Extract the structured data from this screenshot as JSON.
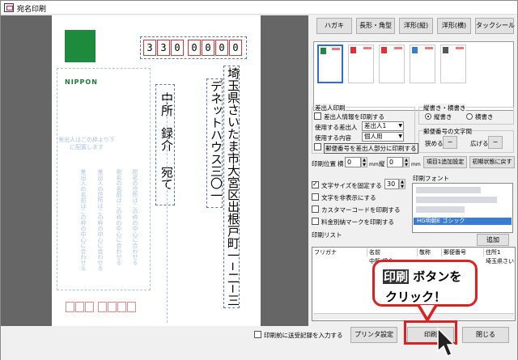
{
  "window": {
    "title": "宛名印刷"
  },
  "card": {
    "logo_text": "NIPPON",
    "zip_digits": [
      "3",
      "3",
      "0",
      "0",
      "0",
      "0",
      "0"
    ],
    "address_line1": "埼玉県さいたま市大宮区出根戸町一−二−三",
    "address_line2": "デネットハウス三〇一",
    "recipient_name_prefix": "中所",
    "recipient_name_first": "録介",
    "recipient_honorific": "宛て",
    "sender_note": "差出人はこの枠より下に配置します",
    "ghost_sender_addr": "差出人の住所はこの枠の中心に合わせる",
    "ghost_sender_name": "差出人の名前はこの枠の中心に合わせる",
    "ghost_recipient_addr": "宛名の住所はこの枠の中心に合わせる",
    "ghost_recipient_name": "宛名の名前はこの枠の中心に合わせる"
  },
  "toolbar": {
    "hagaki": "ハガキ",
    "chokei": "長形・角型",
    "yokei_tate": "洋形(縦)",
    "yokei_yoko": "洋形(横)",
    "tack_seal": "タックシール"
  },
  "sender": {
    "group_label": "差出人印刷",
    "print_sender": "差出人情報を印刷する",
    "use_sender_label": "使用する差出人",
    "use_sender_value": "差出人1",
    "use_content_label": "使用する内容",
    "use_content_value": "個人用",
    "print_zip_sender": "郵便番号を差出人部分に印刷する"
  },
  "orientation": {
    "group_label": "縦書き・横書き",
    "vertical": "縦書き",
    "horizontal": "横書き"
  },
  "zip_spacing": {
    "group_label": "郵便番号の文字間",
    "narrow": "狭める",
    "widen": "広げる",
    "minus": "−"
  },
  "position": {
    "label": "印刷位置",
    "x_label": "横",
    "x_value": "0",
    "y_label": "縦",
    "y_value": "0",
    "unit": "mm",
    "item_adjust": "項目1追加設定",
    "reset": "初期状態に戻す"
  },
  "options": {
    "fix_font_size": "文字サイズを固定する",
    "fix_font_size_value": "30",
    "hide_text": "文字を非表示にする",
    "customer_barcode": "カスタマーコードを印刷する",
    "postage_mark": "料金別納マークを印刷する"
  },
  "font": {
    "group_label": "印刷フォント",
    "selected": "HG明朝E ゴシック"
  },
  "list": {
    "label": "印刷リスト",
    "add": "追加",
    "columns": [
      "フリガナ",
      "名前",
      "敬称",
      "郵便番号",
      "住所1"
    ],
    "row1": [
      "",
      "中所 録介",
      "",
      "",
      "埼玉県さい"
    ]
  },
  "bottom": {
    "record_history": "印刷前に送受記録を入力する",
    "printer_settings": "プリンタ設定",
    "print": "印刷",
    "close": "閉じる"
  },
  "callout": {
    "highlight": "印刷",
    "line1_rest": " ボタンを",
    "line2": "クリック！"
  },
  "colors": {
    "accent": "#e02020",
    "logo_green": "#1e8a3c",
    "selection_blue": "#3a7bd5"
  }
}
